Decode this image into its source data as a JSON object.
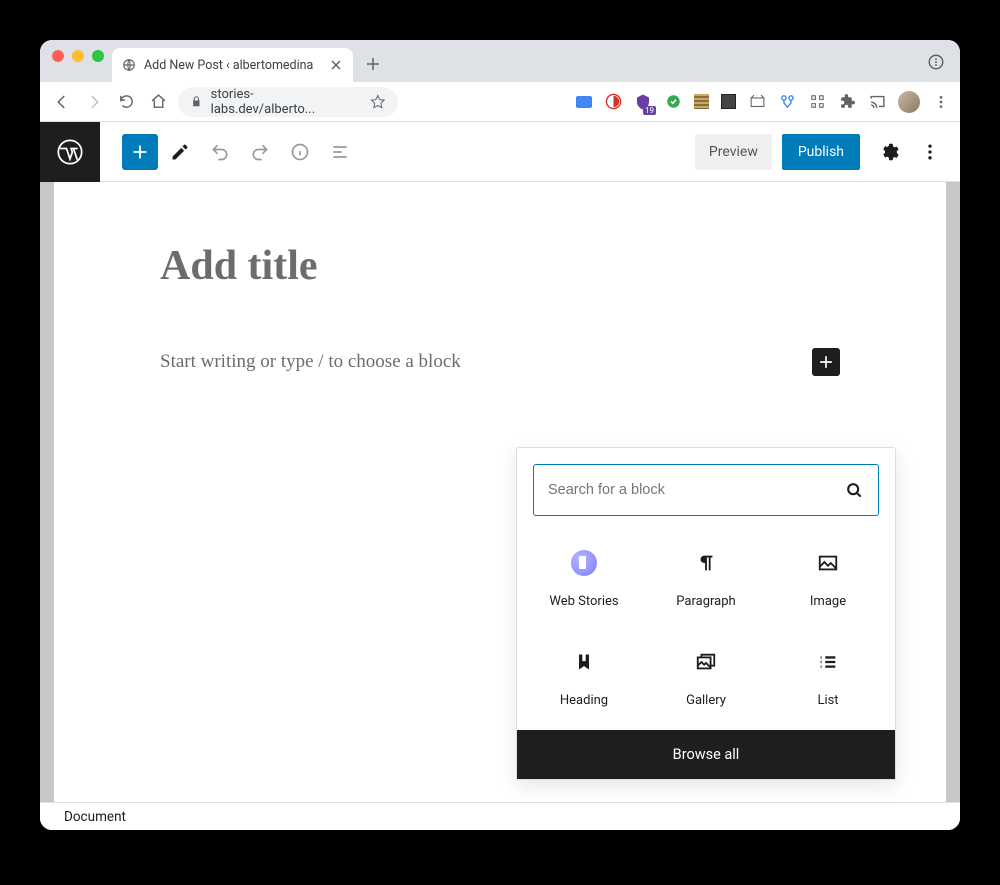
{
  "browser": {
    "tab_title": "Add New Post ‹ albertomedina",
    "url_display": "stories-labs.dev/alberto..."
  },
  "toolbar": {
    "preview_label": "Preview",
    "publish_label": "Publish"
  },
  "editor": {
    "title_placeholder": "Add title",
    "body_placeholder": "Start writing or type / to choose a block"
  },
  "inserter": {
    "search_placeholder": "Search for a block",
    "blocks": [
      {
        "label": "Web Stories"
      },
      {
        "label": "Paragraph"
      },
      {
        "label": "Image"
      },
      {
        "label": "Heading"
      },
      {
        "label": "Gallery"
      },
      {
        "label": "List"
      }
    ],
    "browse_all_label": "Browse all"
  },
  "footer": {
    "breadcrumb": "Document"
  },
  "extension_badge": "19"
}
